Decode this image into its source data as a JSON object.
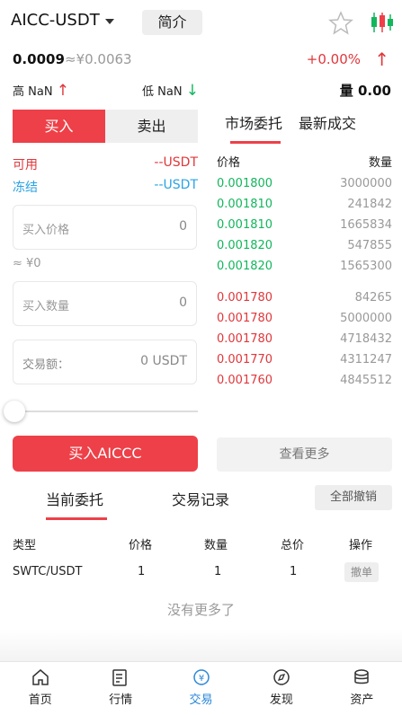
{
  "header": {
    "pair": "AICC-USDT",
    "intro_label": "简介",
    "price": "0.0009",
    "price_cny": "≈¥0.0063",
    "change": "+0.00%",
    "change_arrow": "↑",
    "high_label": "高 NaN",
    "high_arrow": "↑",
    "low_label": "低 NaN",
    "low_arrow": "↓",
    "volume": "量 0.00"
  },
  "trade": {
    "buy_tab": "买入",
    "sell_tab": "卖出",
    "available_label": "可用",
    "available_value": "--USDT",
    "frozen_label": "冻结",
    "frozen_value": "--USDT",
    "price_placeholder": "买入价格",
    "price_value": "0",
    "approx": "≈ ¥0",
    "amount_placeholder": "买入数量",
    "amount_value": "0",
    "total_label": "交易额：",
    "total_value": "0 USDT",
    "slider_percent": 0,
    "buy_button": "买入AICCC"
  },
  "orderbook": {
    "tab_market": "市场委托",
    "tab_latest": "最新成交",
    "col_price": "价格",
    "col_qty": "数量",
    "bids": [
      {
        "price": "0.001800",
        "qty": "3000000"
      },
      {
        "price": "0.001810",
        "qty": "241842"
      },
      {
        "price": "0.001810",
        "qty": "1665834"
      },
      {
        "price": "0.001820",
        "qty": "547855"
      },
      {
        "price": "0.001820",
        "qty": "1565300"
      }
    ],
    "asks": [
      {
        "price": "0.001780",
        "qty": "84265"
      },
      {
        "price": "0.001780",
        "qty": "5000000"
      },
      {
        "price": "0.001780",
        "qty": "4718432"
      },
      {
        "price": "0.001770",
        "qty": "4311247"
      },
      {
        "price": "0.001760",
        "qty": "4845512"
      }
    ],
    "more_button": "查看更多"
  },
  "orders": {
    "tab_current": "当前委托",
    "tab_history": "交易记录",
    "cancel_all": "全部撤销",
    "headers": [
      "类型",
      "价格",
      "数量",
      "总价",
      "操作"
    ],
    "rows": [
      {
        "type": "SWTC/USDT",
        "price": "1",
        "qty": "1",
        "total": "1",
        "action": "撤单"
      }
    ],
    "no_more": "没有更多了"
  },
  "nav": [
    {
      "label": "首页",
      "icon": "home-icon"
    },
    {
      "label": "行情",
      "icon": "market-icon"
    },
    {
      "label": "交易",
      "icon": "trade-icon",
      "active": true
    },
    {
      "label": "发现",
      "icon": "discover-icon"
    },
    {
      "label": "资产",
      "icon": "assets-icon"
    }
  ],
  "colors": {
    "accent_red": "#ee4048",
    "green": "#12b65c",
    "blue": "#2aa3e4",
    "nav_active": "#2a87d8"
  }
}
